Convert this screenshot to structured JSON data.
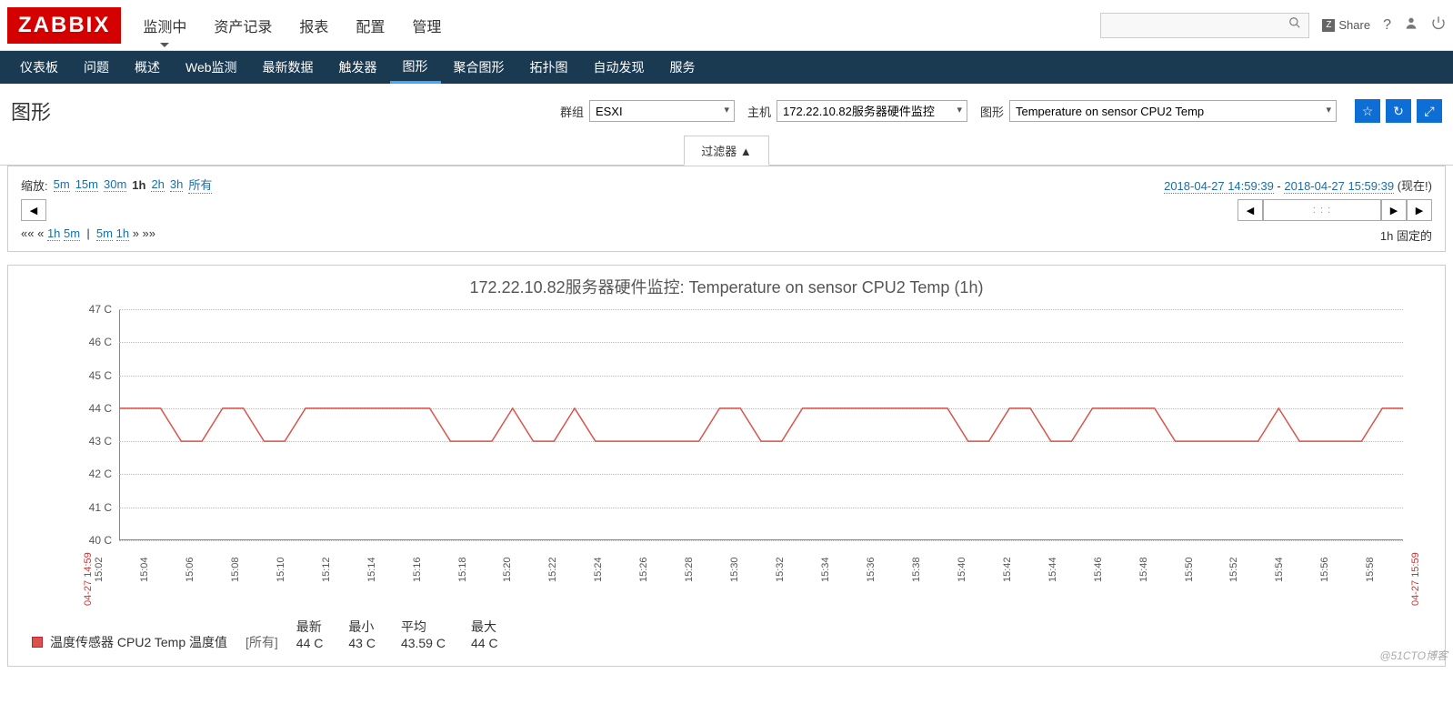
{
  "header": {
    "logo": "ZABBIX",
    "main_tabs": [
      "监测中",
      "资产记录",
      "报表",
      "配置",
      "管理"
    ],
    "main_active": 0,
    "share": "Share",
    "search_placeholder": ""
  },
  "subnav": {
    "items": [
      "仪表板",
      "问题",
      "概述",
      "Web监测",
      "最新数据",
      "触发器",
      "图形",
      "聚合图形",
      "拓扑图",
      "自动发现",
      "服务"
    ],
    "active": 6
  },
  "page": {
    "title": "图形",
    "group_label": "群组",
    "group_value": "ESXI",
    "host_label": "主机",
    "host_value": "172.22.10.82服务器硬件监控",
    "graph_label": "图形",
    "graph_value": "Temperature on sensor CPU2 Temp"
  },
  "filter": {
    "tab": "过滤器 ▲",
    "zoom_label": "缩放:",
    "zoom_opts": [
      "5m",
      "15m",
      "30m",
      "1h",
      "2h",
      "3h",
      "所有"
    ],
    "zoom_active": 3,
    "from": "2018-04-27 14:59:39",
    "to": "2018-04-27 15:59:39",
    "now": "(现在!)",
    "quick_left_prefix": "«« «",
    "quick_left": [
      "1h",
      "5m"
    ],
    "quick_right": [
      "5m",
      "1h"
    ],
    "quick_right_suffix": "» »»",
    "fixed_label": "1h  固定的"
  },
  "chart_data": {
    "type": "line",
    "title": "172.22.10.82服务器硬件监控: Temperature on sensor CPU2 Temp (1h)",
    "ylabel": "C",
    "ylim": [
      40,
      47
    ],
    "yticks": [
      40,
      41,
      42,
      43,
      44,
      45,
      46,
      47
    ],
    "x_start_label": "04-27 14:59",
    "x_end_label": "04-27 15:59",
    "categories": [
      "15:02",
      "15:04",
      "15:06",
      "15:08",
      "15:10",
      "15:12",
      "15:14",
      "15:16",
      "15:18",
      "15:20",
      "15:22",
      "15:24",
      "15:26",
      "15:28",
      "15:30",
      "15:32",
      "15:34",
      "15:36",
      "15:38",
      "15:40",
      "15:42",
      "15:44",
      "15:46",
      "15:48",
      "15:50",
      "15:52",
      "15:54",
      "15:56",
      "15:58"
    ],
    "series": [
      {
        "name": "温度传感器 CPU2 Temp 温度值",
        "color": "#d9534a",
        "values": [
          44,
          44,
          44,
          43,
          43,
          44,
          44,
          43,
          43,
          44,
          44,
          44,
          44,
          44,
          44,
          44,
          43,
          43,
          43,
          44,
          43,
          43,
          44,
          43,
          43,
          43,
          43,
          43,
          43,
          44,
          44,
          43,
          43,
          44,
          44,
          44,
          44,
          44,
          44,
          44,
          44,
          43,
          43,
          44,
          44,
          43,
          43,
          44,
          44,
          44,
          44,
          43,
          43,
          43,
          43,
          43,
          44,
          43,
          43,
          43,
          43,
          44,
          44
        ]
      }
    ]
  },
  "legend": {
    "name": "温度传感器 CPU2 Temp 温度值",
    "scope": "[所有]",
    "cols": [
      {
        "h": "最新",
        "v": "44 C"
      },
      {
        "h": "最小",
        "v": "43 C"
      },
      {
        "h": "平均",
        "v": "43.59 C"
      },
      {
        "h": "最大",
        "v": "44 C"
      }
    ]
  },
  "watermark": "@51CTO博客"
}
